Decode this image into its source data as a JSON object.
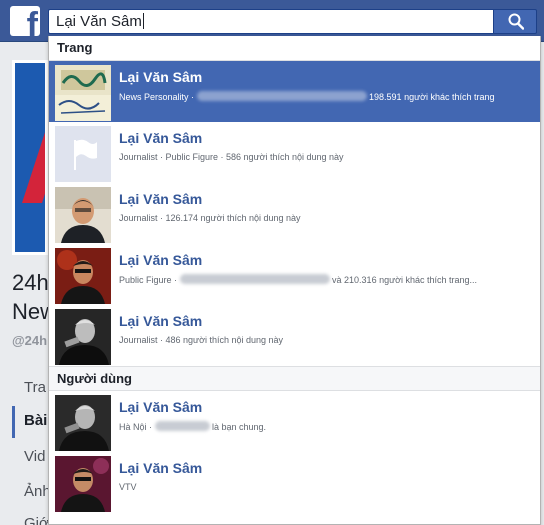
{
  "header": {
    "logo_letter": "f",
    "search_query": "Lại Văn Sâm"
  },
  "background": {
    "name_line1": "24h",
    "name_line2": "New",
    "handle": "@24h",
    "nav": [
      "Tra",
      "Bài",
      "Vid",
      "Ảnh",
      "Giớ"
    ]
  },
  "dropdown": {
    "pages_header": "Trang",
    "people_header": "Người dùng",
    "pages": [
      {
        "name": "Lại Văn Sâm",
        "desc_before": "News Personality · ",
        "desc_after": " 198.591 người khác thích trang",
        "selected": true
      },
      {
        "name": "Lại Văn Sâm",
        "desc_before": "Journalist · Public Figure · 586 người thích nội dung này",
        "desc_after": "",
        "selected": false
      },
      {
        "name": "Lại Văn Sâm",
        "desc_before": "Journalist · 126.174 người thích nội dung này",
        "desc_after": "",
        "selected": false
      },
      {
        "name": "Lại Văn Sâm",
        "desc_before": "Public Figure · ",
        "desc_after": " và 210.316 người khác thích trang...",
        "selected": false
      },
      {
        "name": "Lại Văn Sâm",
        "desc_before": "Journalist · 486 người thích nội dung này",
        "desc_after": "",
        "selected": false
      }
    ],
    "people": [
      {
        "name": "Lại Văn Sâm",
        "desc_before": "Hà Nội · ",
        "desc_after": " là bạn chung."
      },
      {
        "name": "Lại Văn Sâm",
        "desc_before": "VTV",
        "desc_after": ""
      }
    ]
  },
  "colors": {
    "brand": "#3b5998",
    "selected_row": "#4267b2",
    "link": "#365899"
  }
}
